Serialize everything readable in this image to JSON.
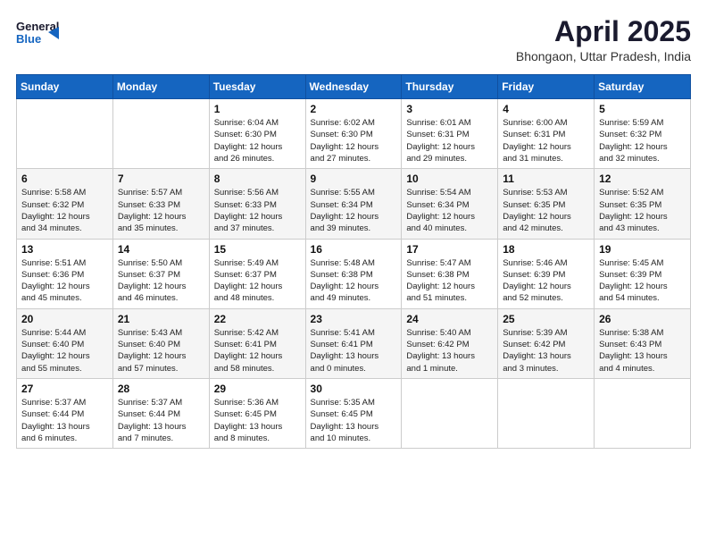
{
  "header": {
    "logo_line1": "General",
    "logo_line2": "Blue",
    "title": "April 2025",
    "location": "Bhongaon, Uttar Pradesh, India"
  },
  "days_of_week": [
    "Sunday",
    "Monday",
    "Tuesday",
    "Wednesday",
    "Thursday",
    "Friday",
    "Saturday"
  ],
  "weeks": [
    [
      {
        "day": "",
        "detail": ""
      },
      {
        "day": "",
        "detail": ""
      },
      {
        "day": "1",
        "detail": "Sunrise: 6:04 AM\nSunset: 6:30 PM\nDaylight: 12 hours\nand 26 minutes."
      },
      {
        "day": "2",
        "detail": "Sunrise: 6:02 AM\nSunset: 6:30 PM\nDaylight: 12 hours\nand 27 minutes."
      },
      {
        "day": "3",
        "detail": "Sunrise: 6:01 AM\nSunset: 6:31 PM\nDaylight: 12 hours\nand 29 minutes."
      },
      {
        "day": "4",
        "detail": "Sunrise: 6:00 AM\nSunset: 6:31 PM\nDaylight: 12 hours\nand 31 minutes."
      },
      {
        "day": "5",
        "detail": "Sunrise: 5:59 AM\nSunset: 6:32 PM\nDaylight: 12 hours\nand 32 minutes."
      }
    ],
    [
      {
        "day": "6",
        "detail": "Sunrise: 5:58 AM\nSunset: 6:32 PM\nDaylight: 12 hours\nand 34 minutes."
      },
      {
        "day": "7",
        "detail": "Sunrise: 5:57 AM\nSunset: 6:33 PM\nDaylight: 12 hours\nand 35 minutes."
      },
      {
        "day": "8",
        "detail": "Sunrise: 5:56 AM\nSunset: 6:33 PM\nDaylight: 12 hours\nand 37 minutes."
      },
      {
        "day": "9",
        "detail": "Sunrise: 5:55 AM\nSunset: 6:34 PM\nDaylight: 12 hours\nand 39 minutes."
      },
      {
        "day": "10",
        "detail": "Sunrise: 5:54 AM\nSunset: 6:34 PM\nDaylight: 12 hours\nand 40 minutes."
      },
      {
        "day": "11",
        "detail": "Sunrise: 5:53 AM\nSunset: 6:35 PM\nDaylight: 12 hours\nand 42 minutes."
      },
      {
        "day": "12",
        "detail": "Sunrise: 5:52 AM\nSunset: 6:35 PM\nDaylight: 12 hours\nand 43 minutes."
      }
    ],
    [
      {
        "day": "13",
        "detail": "Sunrise: 5:51 AM\nSunset: 6:36 PM\nDaylight: 12 hours\nand 45 minutes."
      },
      {
        "day": "14",
        "detail": "Sunrise: 5:50 AM\nSunset: 6:37 PM\nDaylight: 12 hours\nand 46 minutes."
      },
      {
        "day": "15",
        "detail": "Sunrise: 5:49 AM\nSunset: 6:37 PM\nDaylight: 12 hours\nand 48 minutes."
      },
      {
        "day": "16",
        "detail": "Sunrise: 5:48 AM\nSunset: 6:38 PM\nDaylight: 12 hours\nand 49 minutes."
      },
      {
        "day": "17",
        "detail": "Sunrise: 5:47 AM\nSunset: 6:38 PM\nDaylight: 12 hours\nand 51 minutes."
      },
      {
        "day": "18",
        "detail": "Sunrise: 5:46 AM\nSunset: 6:39 PM\nDaylight: 12 hours\nand 52 minutes."
      },
      {
        "day": "19",
        "detail": "Sunrise: 5:45 AM\nSunset: 6:39 PM\nDaylight: 12 hours\nand 54 minutes."
      }
    ],
    [
      {
        "day": "20",
        "detail": "Sunrise: 5:44 AM\nSunset: 6:40 PM\nDaylight: 12 hours\nand 55 minutes."
      },
      {
        "day": "21",
        "detail": "Sunrise: 5:43 AM\nSunset: 6:40 PM\nDaylight: 12 hours\nand 57 minutes."
      },
      {
        "day": "22",
        "detail": "Sunrise: 5:42 AM\nSunset: 6:41 PM\nDaylight: 12 hours\nand 58 minutes."
      },
      {
        "day": "23",
        "detail": "Sunrise: 5:41 AM\nSunset: 6:41 PM\nDaylight: 13 hours\nand 0 minutes."
      },
      {
        "day": "24",
        "detail": "Sunrise: 5:40 AM\nSunset: 6:42 PM\nDaylight: 13 hours\nand 1 minute."
      },
      {
        "day": "25",
        "detail": "Sunrise: 5:39 AM\nSunset: 6:42 PM\nDaylight: 13 hours\nand 3 minutes."
      },
      {
        "day": "26",
        "detail": "Sunrise: 5:38 AM\nSunset: 6:43 PM\nDaylight: 13 hours\nand 4 minutes."
      }
    ],
    [
      {
        "day": "27",
        "detail": "Sunrise: 5:37 AM\nSunset: 6:44 PM\nDaylight: 13 hours\nand 6 minutes."
      },
      {
        "day": "28",
        "detail": "Sunrise: 5:37 AM\nSunset: 6:44 PM\nDaylight: 13 hours\nand 7 minutes."
      },
      {
        "day": "29",
        "detail": "Sunrise: 5:36 AM\nSunset: 6:45 PM\nDaylight: 13 hours\nand 8 minutes."
      },
      {
        "day": "30",
        "detail": "Sunrise: 5:35 AM\nSunset: 6:45 PM\nDaylight: 13 hours\nand 10 minutes."
      },
      {
        "day": "",
        "detail": ""
      },
      {
        "day": "",
        "detail": ""
      },
      {
        "day": "",
        "detail": ""
      }
    ]
  ]
}
